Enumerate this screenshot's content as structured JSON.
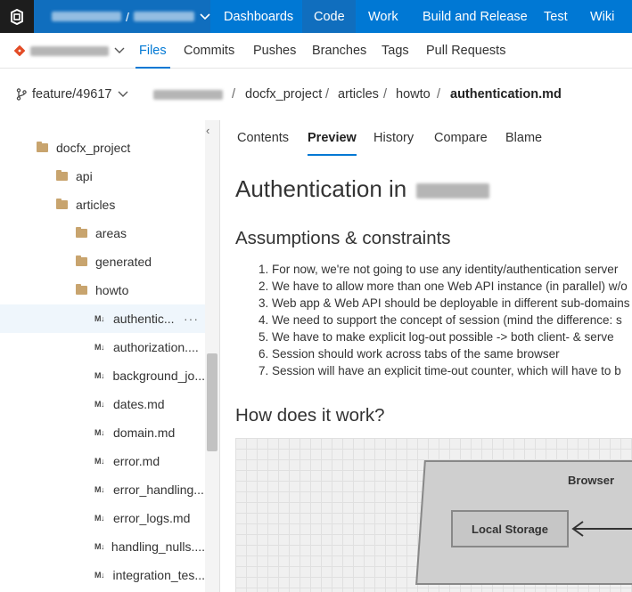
{
  "topbar": {
    "nav": [
      {
        "label": "Dashboards"
      },
      {
        "label": "Code"
      },
      {
        "label": "Work"
      },
      {
        "label": "Build and Release"
      },
      {
        "label": "Test"
      },
      {
        "label": "Wiki"
      }
    ],
    "crumb_sep": "/"
  },
  "subbar": {
    "tabs": [
      {
        "label": "Files"
      },
      {
        "label": "Commits"
      },
      {
        "label": "Pushes"
      },
      {
        "label": "Branches"
      },
      {
        "label": "Tags"
      },
      {
        "label": "Pull Requests"
      }
    ]
  },
  "breadcrumb": {
    "branch": "feature/49617",
    "parts": [
      "docfx_project",
      "articles",
      "howto"
    ],
    "current": "authentication.md",
    "sep": "/"
  },
  "tree": {
    "items": [
      {
        "type": "folder",
        "label": "docfx_project"
      },
      {
        "type": "folder",
        "label": "api"
      },
      {
        "type": "folder",
        "label": "articles"
      },
      {
        "type": "folder",
        "label": "areas"
      },
      {
        "type": "folder",
        "label": "generated"
      },
      {
        "type": "folder",
        "label": "howto"
      },
      {
        "type": "file",
        "label": "authentic...",
        "more": "···"
      },
      {
        "type": "file",
        "label": "authorization...."
      },
      {
        "type": "file",
        "label": "background_jo..."
      },
      {
        "type": "file",
        "label": "dates.md"
      },
      {
        "type": "file",
        "label": "domain.md"
      },
      {
        "type": "file",
        "label": "error.md"
      },
      {
        "type": "file",
        "label": "error_handling..."
      },
      {
        "type": "file",
        "label": "error_logs.md"
      },
      {
        "type": "file",
        "label": "handling_nulls...."
      },
      {
        "type": "file",
        "label": "integration_tes..."
      }
    ],
    "md_icon": "M↓",
    "collapse": "‹"
  },
  "content": {
    "tabs": [
      {
        "label": "Contents"
      },
      {
        "label": "Preview"
      },
      {
        "label": "History"
      },
      {
        "label": "Compare"
      },
      {
        "label": "Blame"
      }
    ],
    "title": "Authentication in",
    "h2_assumptions": "Assumptions & constraints",
    "list": [
      "1. For now, we're not going to use any identity/authentication server",
      "2. We have to allow more than one Web API instance (in parallel) w/o",
      "3. Web app & Web API should be deployable in different sub-domains",
      "4. We need to support the concept of session (mind the difference: s",
      "5. We have to make explicit log-out possible -> both client- & serve",
      "6. Session should work across tabs of the same browser",
      "7. Session will have an explicit time-out counter, which will have to b"
    ],
    "h2_how": "How does it work?",
    "diagram": {
      "browser_label": "Browser",
      "storage_label": "Local Storage"
    }
  },
  "colors": {
    "accent": "#0078d4",
    "logo_bg": "#1d1d1d",
    "folder": "#c8a46e",
    "git_red": "#e34c26"
  }
}
